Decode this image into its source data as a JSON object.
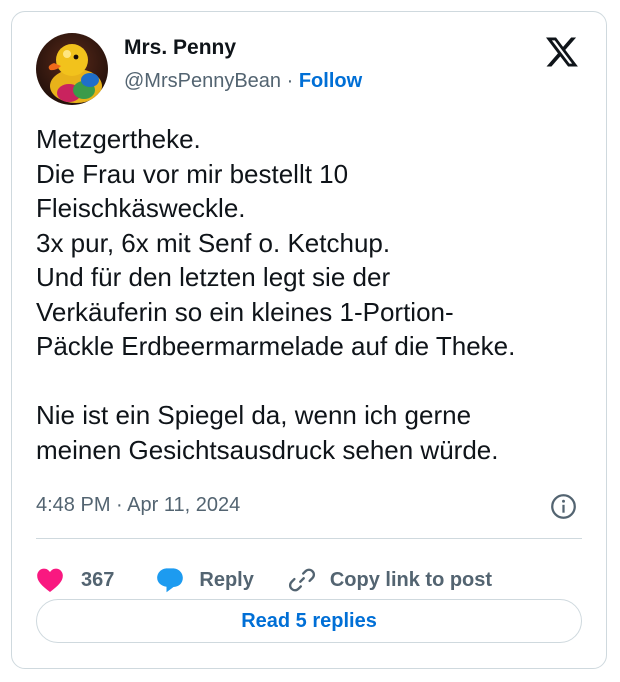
{
  "author": {
    "display_name": "Mrs. Penny",
    "handle": "@MrsPennyBean",
    "separator": " · ",
    "follow_label": "Follow",
    "avatar_icon": "rubber-duck-avatar"
  },
  "brand_icon": "x-logo-icon",
  "tweet": {
    "lines": [
      "Metzgertheke.",
      "Die Frau vor mir bestellt 10",
      "Fleischkäsweckle.",
      "3x pur, 6x mit Senf o. Ketchup.",
      "Und für den letzten legt sie der",
      "Verkäuferin so ein kleines 1-Portion-",
      "Päckle Erdbeermarmelade auf die Theke.",
      "",
      "Nie ist ein Spiegel da, wenn ich gerne",
      "meinen Gesichtsausdruck sehen würde."
    ],
    "timestamp": "4:48 PM · Apr 11, 2024"
  },
  "actions": {
    "like_count": "367",
    "reply_label": "Reply",
    "copy_link_label": "Copy link to post",
    "read_replies_label": "Read 5 replies"
  },
  "colors": {
    "like": "#f91880",
    "reply": "#1d9bf0",
    "link": "#006fd6",
    "secondary_text": "#536471",
    "border": "#cfd9de"
  }
}
